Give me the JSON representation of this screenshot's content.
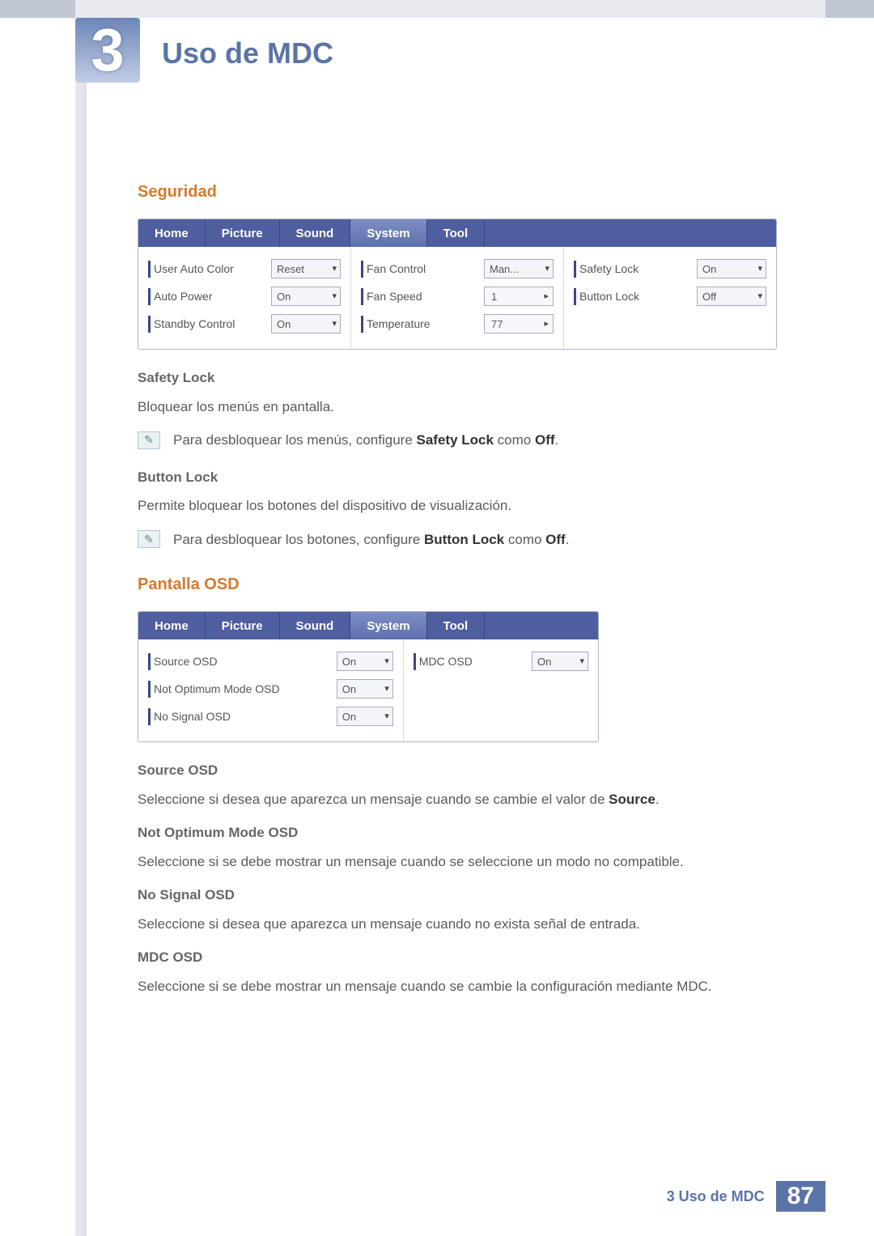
{
  "chapter": {
    "number": "3",
    "title": "Uso de MDC"
  },
  "section_security": {
    "heading": "Seguridad",
    "tabs": [
      "Home",
      "Picture",
      "Sound",
      "System",
      "Tool"
    ],
    "col1": [
      {
        "label": "User Auto Color",
        "value": "Reset"
      },
      {
        "label": "Auto Power",
        "value": "On"
      },
      {
        "label": "Standby Control",
        "value": "On"
      }
    ],
    "col2": [
      {
        "label": "Fan Control",
        "value": "Man..."
      },
      {
        "label": "Fan Speed",
        "value": "1"
      },
      {
        "label": "Temperature",
        "value": "77"
      }
    ],
    "col3": [
      {
        "label": "Safety Lock",
        "value": "On"
      },
      {
        "label": "Button Lock",
        "value": "Off"
      }
    ],
    "safety_lock": {
      "title": "Safety Lock",
      "desc": "Bloquear los menús en pantalla.",
      "note_pre": "Para desbloquear los menús, configure ",
      "note_bold1": "Safety Lock",
      "note_mid": " como ",
      "note_bold2": "Off",
      "note_end": "."
    },
    "button_lock": {
      "title": "Button Lock",
      "desc": "Permite bloquear los botones del dispositivo de visualización.",
      "note_pre": "Para desbloquear los botones, configure ",
      "note_bold1": "Button Lock",
      "note_mid": " como ",
      "note_bold2": "Off",
      "note_end": "."
    }
  },
  "section_osd": {
    "heading": "Pantalla OSD",
    "tabs": [
      "Home",
      "Picture",
      "Sound",
      "System",
      "Tool"
    ],
    "col1": [
      {
        "label": "Source OSD",
        "value": "On"
      },
      {
        "label": "Not Optimum Mode OSD",
        "value": "On"
      },
      {
        "label": "No Signal OSD",
        "value": "On"
      }
    ],
    "col2": [
      {
        "label": "MDC OSD",
        "value": "On"
      }
    ],
    "items": {
      "source": {
        "title": "Source OSD",
        "pre": "Seleccione si desea que aparezca un mensaje cuando se cambie el valor de ",
        "bold": "Source",
        "end": "."
      },
      "notopt": {
        "title": "Not Optimum Mode OSD",
        "desc": "Seleccione si se debe mostrar un mensaje cuando se seleccione un modo no compatible."
      },
      "nosignal": {
        "title": "No Signal OSD",
        "desc": "Seleccione si desea que aparezca un mensaje cuando no exista señal de entrada."
      },
      "mdc": {
        "title": "MDC OSD",
        "desc": "Seleccione si se debe mostrar un mensaje cuando se cambie la configuración mediante MDC."
      }
    }
  },
  "footer": {
    "text": "3 Uso de MDC",
    "page": "87"
  }
}
